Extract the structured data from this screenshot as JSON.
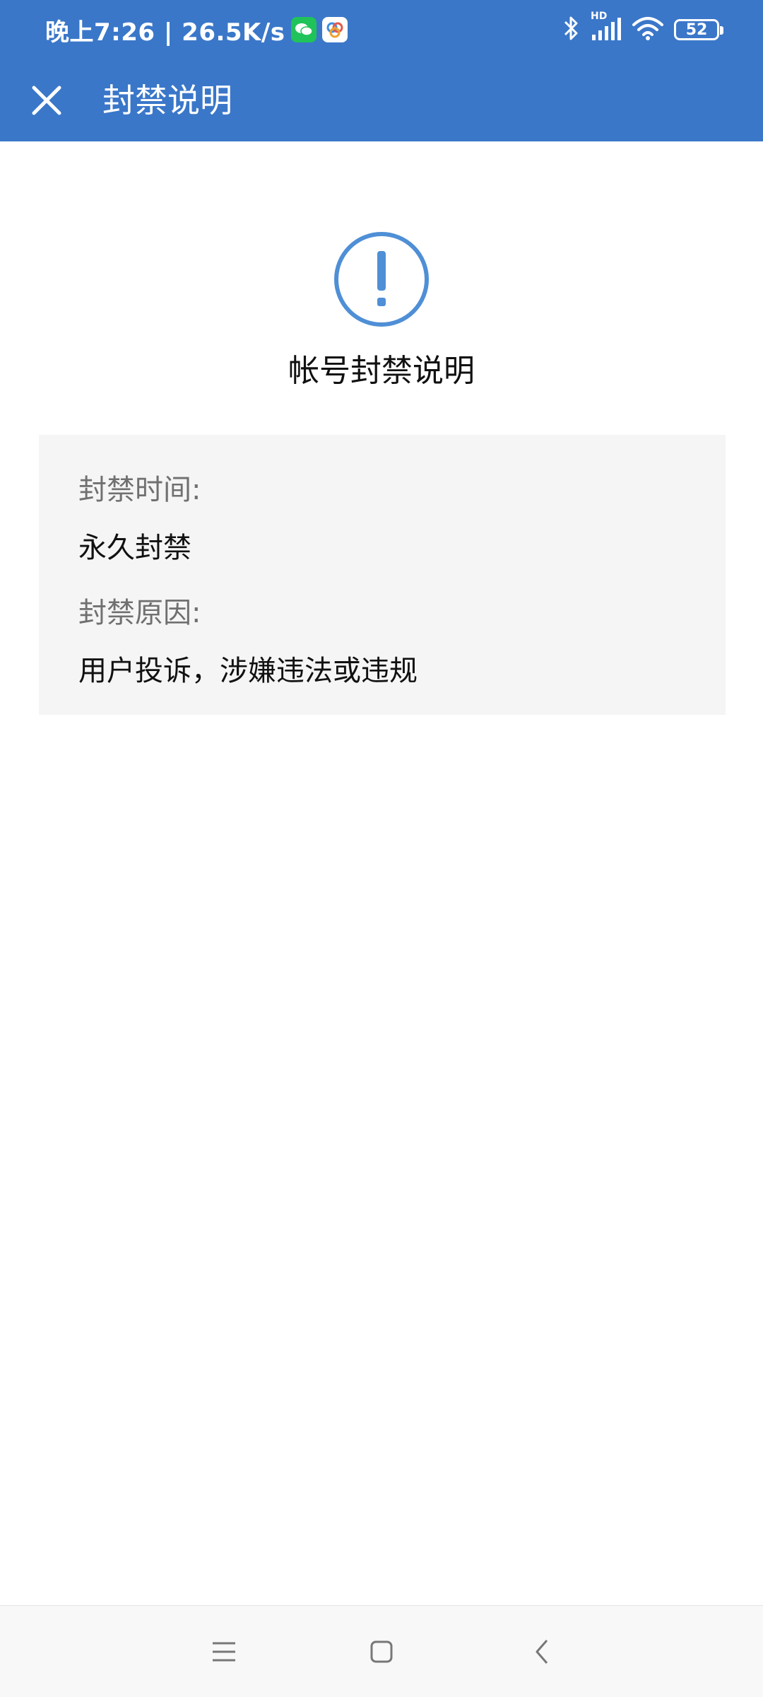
{
  "status_bar": {
    "time_speed": "晚上7:26 | 26.5K/s",
    "battery": "52",
    "network_badge": "HD",
    "icons": [
      "wechat-icon",
      "app-icon",
      "bluetooth-icon",
      "signal-icon",
      "wifi-icon",
      "battery-icon"
    ]
  },
  "app_bar": {
    "title": "封禁说明",
    "close_icon": "close-icon"
  },
  "content": {
    "icon": "exclamation-circle-icon",
    "title": "帐号封禁说明",
    "ban_time_label": "封禁时间:",
    "ban_time_value": "永久封禁",
    "ban_reason_label": "封禁原因:",
    "ban_reason_value": "用户投诉，涉嫌违法或违规"
  },
  "nav_bar": {
    "icons": [
      "menu-icon",
      "home-icon",
      "back-icon"
    ]
  },
  "colors": {
    "header": "#3a77c9",
    "icon_accent": "#4f8fd6",
    "card_bg": "#f5f5f5"
  }
}
